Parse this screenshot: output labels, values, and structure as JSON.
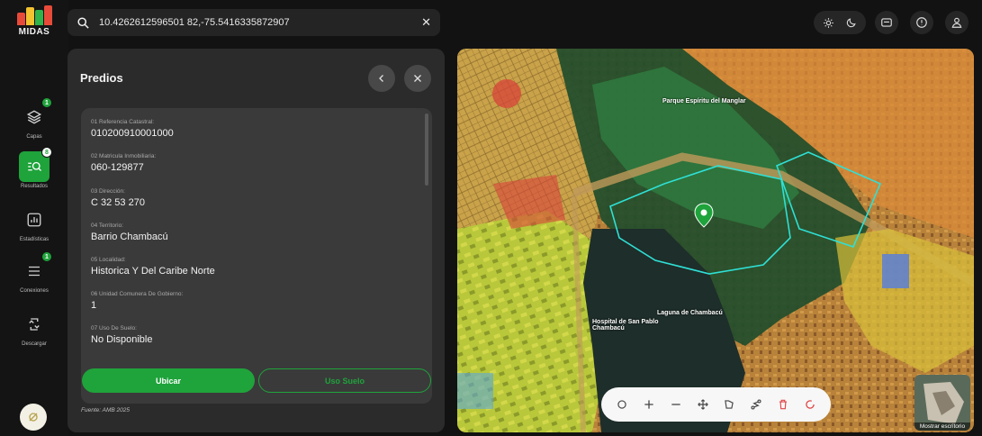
{
  "app": {
    "name": "MIDAS"
  },
  "sidebar": {
    "items": [
      {
        "label": "Capas",
        "badge": "1",
        "icon": "layers-icon"
      },
      {
        "label": "Resultados",
        "badge": "8",
        "icon": "search-results-icon",
        "active": true
      },
      {
        "label": "Estadísticas",
        "badge": "",
        "icon": "bar-chart-icon"
      },
      {
        "label": "Conexiones",
        "badge": "1",
        "icon": "list-icon"
      },
      {
        "label": "Descargar",
        "badge": "",
        "icon": "download-icon"
      }
    ]
  },
  "search": {
    "value": "10.4262612596501 82,-75.5416335872907",
    "clear_icon": "close-icon"
  },
  "topbar": {
    "icons": [
      "sun-icon",
      "moon-icon",
      "mail-icon",
      "help-icon",
      "user-icon"
    ]
  },
  "panel": {
    "title": "Predios",
    "fields": [
      {
        "label": "01 Referencia Catastral:",
        "value": "010200910001000"
      },
      {
        "label": "02 Matricula Inmobiliaria:",
        "value": "060-129877"
      },
      {
        "label": "03 Dirección:",
        "value": "C 32 53 270"
      },
      {
        "label": "04 Territorio:",
        "value": "Barrio Chambacú"
      },
      {
        "label": "05 Localidad:",
        "value": "Historica Y Del Caribe Norte"
      },
      {
        "label": "06 Unidad Comunera De Gobierno:",
        "value": "1"
      },
      {
        "label": "07 Uso De Suelo:",
        "value": "No Disponible"
      }
    ],
    "primary_button": "Ubicar",
    "secondary_button": "Uso Suelo",
    "source": "Fuente: AMB 2025"
  },
  "map": {
    "labels": {
      "laguna": "Laguna de Chambacú",
      "parque": "Parque Espíritu del Manglar",
      "hospital": "Hospital de San Pablo Chambacú"
    },
    "basemap_label": "Mostrar escritorio",
    "colors": {
      "boundary": "#2fe0d6",
      "marker": "#1fa33b"
    }
  }
}
